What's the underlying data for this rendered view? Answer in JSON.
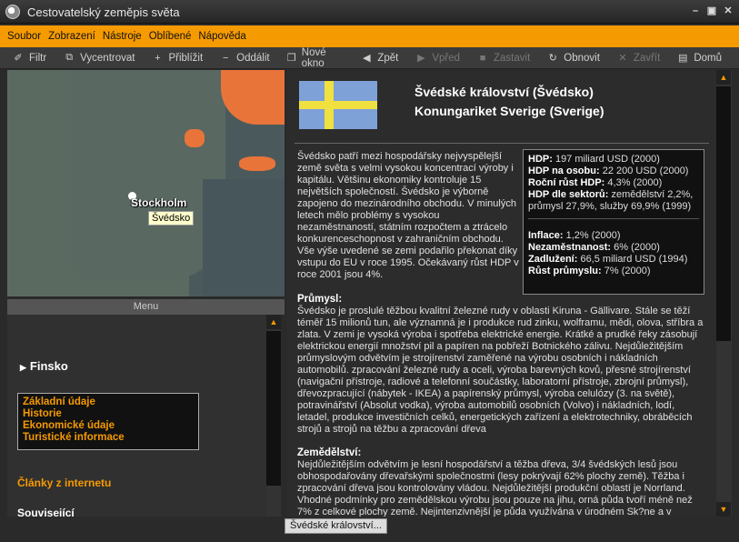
{
  "window": {
    "title": "Cestovatelský zeměpis světa"
  },
  "menubar": {
    "items": [
      "Soubor",
      "Zobrazení",
      "Nástroje",
      "Oblíbené",
      "Nápověda"
    ]
  },
  "toolbar": {
    "items": [
      {
        "label": "Filtr",
        "icon": "pin-icon",
        "glyph": "✐",
        "enabled": true
      },
      {
        "label": "Vycentrovat",
        "icon": "center-icon",
        "glyph": "⧉",
        "enabled": true
      },
      {
        "label": "Přiblížit",
        "icon": "plus-icon",
        "glyph": "+",
        "enabled": true
      },
      {
        "label": "Oddálit",
        "icon": "minus-icon",
        "glyph": "−",
        "enabled": true
      },
      {
        "label": "Nové okno",
        "icon": "new-window-icon",
        "glyph": "❐",
        "enabled": true
      },
      {
        "label": "Zpět",
        "icon": "back-icon",
        "glyph": "◀",
        "enabled": true
      },
      {
        "label": "Vpřed",
        "icon": "forward-icon",
        "glyph": "▶",
        "enabled": false
      },
      {
        "label": "Zastavit",
        "icon": "stop-icon",
        "glyph": "■",
        "enabled": false
      },
      {
        "label": "Obnovit",
        "icon": "refresh-icon",
        "glyph": "↻",
        "enabled": true
      },
      {
        "label": "Zavřít",
        "icon": "close-icon",
        "glyph": "✕",
        "enabled": false
      },
      {
        "label": "Domů",
        "icon": "home-icon",
        "glyph": "▤",
        "enabled": true
      }
    ]
  },
  "map": {
    "city_label": "Stockholm",
    "tooltip": "Švédsko"
  },
  "left_panel": {
    "menu_header": "Menu",
    "country": "Finsko",
    "links": [
      "Základní údaje",
      "Historie",
      "Ekonomické údaje",
      "Turistické informace"
    ],
    "articles": "Články z internetu",
    "related": "Související"
  },
  "country": {
    "name_cz": "Švédské království (Švédsko)",
    "name_local": "Konungariket Sverige (Sverige)",
    "flag_colors": {
      "blue": "#7ea1d8",
      "yellow": "#f0e040"
    }
  },
  "intro": "Švédsko patří mezi hospodářsky nejvyspělejší země světa s velmi vysokou koncentrací výroby i kapitálu. Většinu ekonomiky kontroluje 15 největších společností. Švédsko je výborně zapojeno do mezinárodního obchodu. V minulých letech mělo problémy s vysokou nezaměstnaností, státním rozpočtem a ztrácelo konkurenceschopnost v zahraničním obchodu. Vše výše uvedené se zemi podařilo překonat díky vstupu do EU v roce 1995. Očekávaný růst HDP v roce 2001 jsou 4%.",
  "stats": [
    {
      "label": "HDP:",
      "value": " 197 miliard USD (2000)"
    },
    {
      "label": "HDP na osobu:",
      "value": " 22 200 USD (2000)"
    },
    {
      "label": "Roční růst HDP:",
      "value": " 4,3% (2000)"
    },
    {
      "label": "HDP dle sektorů:",
      "value": " zemědělství 2,2%, průmysl 27,9%, služby 69,9% (1999)"
    },
    {
      "label": "Inflace:",
      "value": " 1,2% (2000)"
    },
    {
      "label": "Nezaměstnanost:",
      "value": " 6% (2000)"
    },
    {
      "label": "Zadlužení:",
      "value": " 66,5 miliard USD (1994)"
    },
    {
      "label": "Růst průmyslu:",
      "value": " 7% (2000)"
    }
  ],
  "sections": [
    {
      "heading": "Průmysl:",
      "text": "Švédsko je proslulé těžbou kvalitní železné rudy v oblasti Kiruna - Gällivare. Stále se těží téměř 15 milionů tun, ale významná je i produkce rud zinku, wolframu, mědi, olova, stříbra a zlata. V zemi je vysoká výroba i spotřeba elektrické energie. Krátké a prudké řeky zásobují elektrickou energií množství pil a papíren na pobřeží Botnického zálivu. Nejdůležitějším průmyslovým odvětvím je strojírenství zaměřené na výrobu osobních i nákladních automobilů. zpracování železné rudy a oceli, výroba barevných kovů, přesné strojírenství (navigační přístroje, radiové a telefonní součástky, laboratorní přístroje, zbrojní průmysl), dřevozpracující (nábytek - IKEA) a papírenský průmysl, výroba celulózy (3. na světě), potravinářství (Absolut vodka), výroba automobilů osobních (Volvo) i nákladních, lodí, letadel, produkce investičních celků, energetických zařízení a elektrotechniky, obráběcích strojů a strojů na těžbu a zpracování dřeva"
    },
    {
      "heading": "Zemědělství:",
      "text": "Nejdůležitějším odvětvím je lesní hospodářství a těžba dřeva, 3/4 švédských lesů jsou obhospodařovány dřevařskými společnostmi (lesy pokrývají 62% plochy země). Těžba i zpracování dřeva jsou kontrolovány vládou. Nejdůležitější produkční oblastí je Norrland. Vhodné podmínky pro zemědělskou výrobu jsou pouze na jihu, orná půda tvoří méně než 7% z celkové plochy země. Nejintenzivnější je půda využívána v úrodném Sk?ne a v nížinách ve"
    }
  ],
  "statusbar": {
    "tab": "Švédské království..."
  },
  "colors": {
    "accent": "#f59a00",
    "background": "#2a2a2a"
  }
}
